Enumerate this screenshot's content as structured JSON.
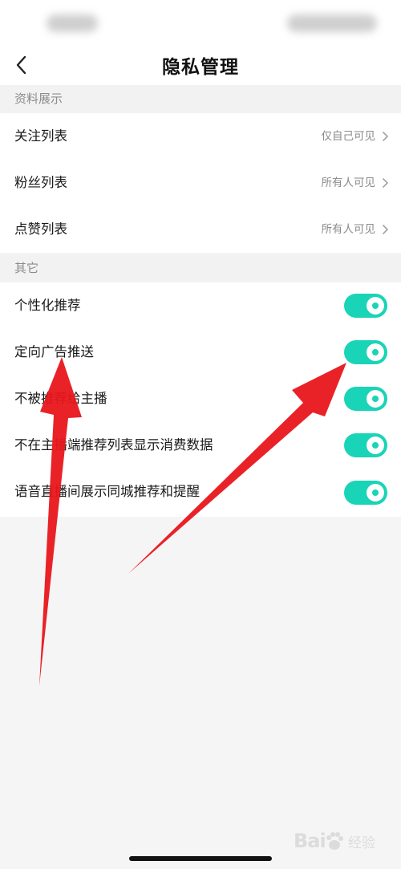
{
  "nav": {
    "title": "隐私管理"
  },
  "sections": [
    {
      "header": "资料展示",
      "rows": [
        {
          "label": "关注列表",
          "value": "仅自己可见"
        },
        {
          "label": "粉丝列表",
          "value": "所有人可见"
        },
        {
          "label": "点赞列表",
          "value": "所有人可见"
        }
      ]
    },
    {
      "header": "其它",
      "rows": [
        {
          "label": "个性化推荐",
          "enabled": true
        },
        {
          "label": "定向广告推送",
          "enabled": true
        },
        {
          "label": "不被推荐给主播",
          "enabled": true
        },
        {
          "label": "不在主播端推荐列表显示消费数据",
          "enabled": true
        },
        {
          "label": "语音直播间展示同城推荐和提醒",
          "enabled": true
        }
      ]
    }
  ],
  "colors": {
    "toggle_on": "#19d4b6",
    "arrow": "#e8161b"
  },
  "watermark": {
    "logo": "Bai",
    "text": "经验"
  }
}
